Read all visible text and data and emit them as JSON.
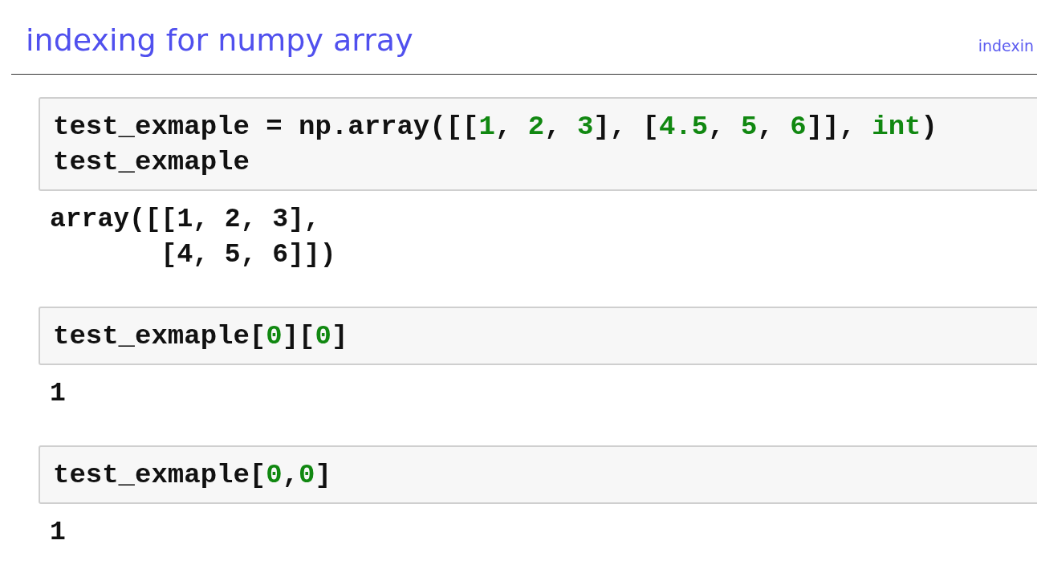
{
  "header": {
    "title": "indexing for numpy array",
    "right_link": "indexin"
  },
  "cells": [
    {
      "input": [
        [
          {
            "kind": "plain",
            "text": "test_exmaple = np.array([["
          },
          {
            "kind": "number",
            "text": "1"
          },
          {
            "kind": "plain",
            "text": ", "
          },
          {
            "kind": "number",
            "text": "2"
          },
          {
            "kind": "plain",
            "text": ", "
          },
          {
            "kind": "number",
            "text": "3"
          },
          {
            "kind": "plain",
            "text": "], ["
          },
          {
            "kind": "number",
            "text": "4.5"
          },
          {
            "kind": "plain",
            "text": ", "
          },
          {
            "kind": "number",
            "text": "5"
          },
          {
            "kind": "plain",
            "text": ", "
          },
          {
            "kind": "number",
            "text": "6"
          },
          {
            "kind": "plain",
            "text": "]], "
          },
          {
            "kind": "builtin",
            "text": "int"
          },
          {
            "kind": "plain",
            "text": ")"
          }
        ],
        [
          {
            "kind": "plain",
            "text": "test_exmaple"
          }
        ]
      ],
      "output": [
        "array([[1, 2, 3],",
        "       [4, 5, 6]])"
      ]
    },
    {
      "input": [
        [
          {
            "kind": "plain",
            "text": "test_exmaple["
          },
          {
            "kind": "number",
            "text": "0"
          },
          {
            "kind": "plain",
            "text": "]["
          },
          {
            "kind": "number",
            "text": "0"
          },
          {
            "kind": "plain",
            "text": "]"
          }
        ]
      ],
      "output": [
        "1"
      ]
    },
    {
      "input": [
        [
          {
            "kind": "plain",
            "text": "test_exmaple["
          },
          {
            "kind": "number",
            "text": "0"
          },
          {
            "kind": "plain",
            "text": ","
          },
          {
            "kind": "number",
            "text": "0"
          },
          {
            "kind": "plain",
            "text": "]"
          }
        ]
      ],
      "output": [
        "1"
      ]
    }
  ]
}
